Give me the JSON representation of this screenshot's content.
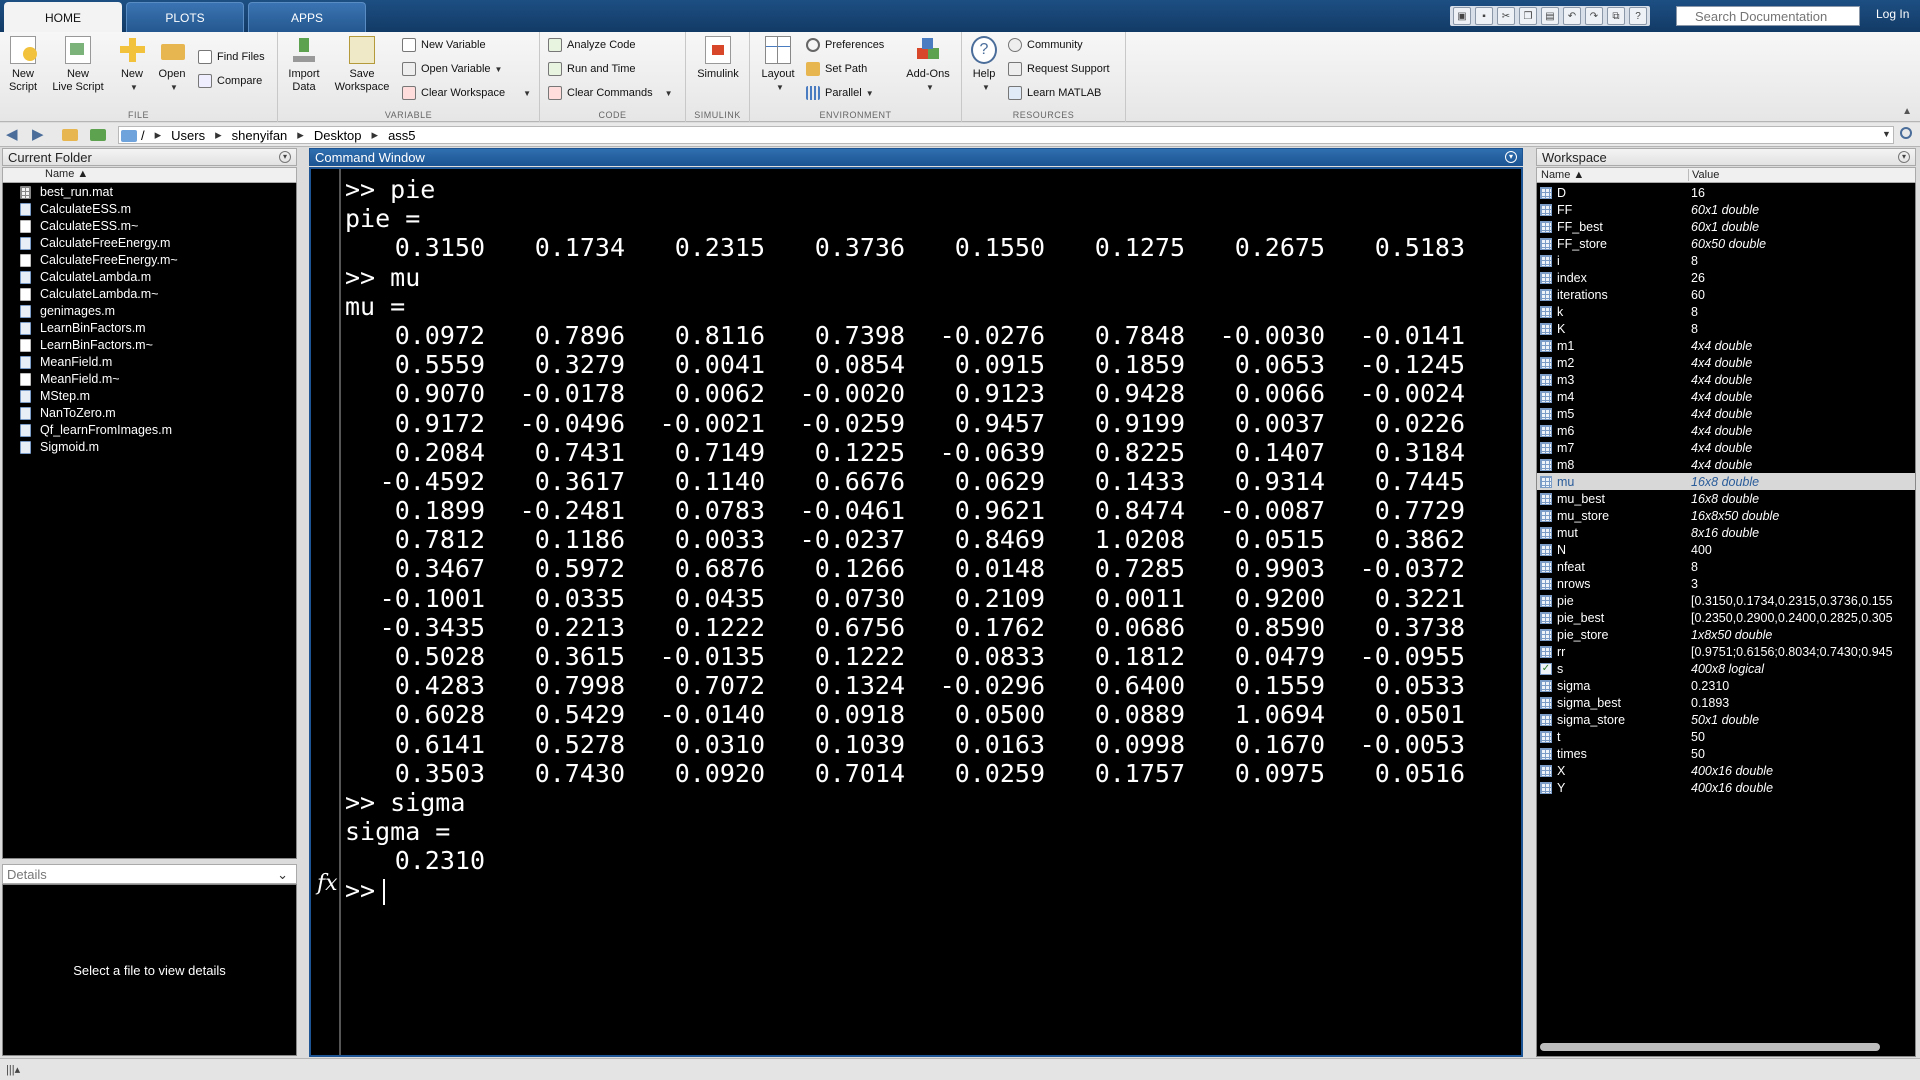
{
  "tabs": [
    "HOME",
    "PLOTS",
    "APPS"
  ],
  "search": {
    "placeholder": "Search Documentation"
  },
  "login": "Log In",
  "ribbon": {
    "file": {
      "label": "FILE",
      "new_script": "New\nScript",
      "new_live_script": "New\nLive Script",
      "new": "New",
      "open": "Open",
      "find_files": "Find Files",
      "compare": "Compare"
    },
    "variable": {
      "label": "VARIABLE",
      "import_data": "Import\nData",
      "save_workspace": "Save\nWorkspace",
      "new_variable": "New Variable",
      "open_variable": "Open Variable",
      "clear_workspace": "Clear Workspace"
    },
    "code": {
      "label": "CODE",
      "analyze_code": "Analyze Code",
      "run_and_time": "Run and Time",
      "clear_commands": "Clear Commands"
    },
    "simulink": {
      "label": "SIMULINK",
      "simulink": "Simulink"
    },
    "environment": {
      "label": "ENVIRONMENT",
      "layout": "Layout",
      "preferences": "Preferences",
      "set_path": "Set Path",
      "parallel": "Parallel",
      "add_ons": "Add-Ons"
    },
    "resources": {
      "label": "RESOURCES",
      "help": "Help",
      "community": "Community",
      "request_support": "Request Support",
      "learn_matlab": "Learn MATLAB"
    }
  },
  "path": [
    "/",
    "Users",
    "shenyifan",
    "Desktop",
    "ass5"
  ],
  "current_folder": {
    "title": "Current Folder",
    "col_name": "Name ▲",
    "files": [
      {
        "name": "best_run.mat",
        "type": "mat"
      },
      {
        "name": "CalculateESS.m",
        "type": "m"
      },
      {
        "name": "CalculateESS.m~",
        "type": "tilde"
      },
      {
        "name": "CalculateFreeEnergy.m",
        "type": "m"
      },
      {
        "name": "CalculateFreeEnergy.m~",
        "type": "tilde"
      },
      {
        "name": "CalculateLambda.m",
        "type": "m"
      },
      {
        "name": "CalculateLambda.m~",
        "type": "tilde"
      },
      {
        "name": "genimages.m",
        "type": "m"
      },
      {
        "name": "LearnBinFactors.m",
        "type": "m"
      },
      {
        "name": "LearnBinFactors.m~",
        "type": "tilde"
      },
      {
        "name": "MeanField.m",
        "type": "m"
      },
      {
        "name": "MeanField.m~",
        "type": "tilde"
      },
      {
        "name": "MStep.m",
        "type": "m"
      },
      {
        "name": "NanToZero.m",
        "type": "m"
      },
      {
        "name": "Qf_learnFromImages.m",
        "type": "m"
      },
      {
        "name": "Sigmoid.m",
        "type": "m"
      }
    ]
  },
  "details": {
    "title": "Details",
    "message": "Select a file to view details"
  },
  "command_window": {
    "title": "Command Window",
    "fx": "fx",
    "prompt": ">>",
    "lines": [
      {
        "kind": "text",
        "text": ">> pie"
      },
      {
        "kind": "text",
        "text": "pie ="
      },
      {
        "kind": "nums",
        "values": [
          "0.3150",
          "0.1734",
          "0.2315",
          "0.3736",
          "0.1550",
          "0.1275",
          "0.2675",
          "0.5183"
        ]
      },
      {
        "kind": "text",
        "text": ">> mu"
      },
      {
        "kind": "text",
        "text": "mu ="
      },
      {
        "kind": "nums",
        "values": [
          "0.0972",
          "0.7896",
          "0.8116",
          "0.7398",
          "-0.0276",
          "0.7848",
          "-0.0030",
          "-0.0141"
        ]
      },
      {
        "kind": "nums",
        "values": [
          "0.5559",
          "0.3279",
          "0.0041",
          "0.0854",
          "0.0915",
          "0.1859",
          "0.0653",
          "-0.1245"
        ]
      },
      {
        "kind": "nums",
        "values": [
          "0.9070",
          "-0.0178",
          "0.0062",
          "-0.0020",
          "0.9123",
          "0.9428",
          "0.0066",
          "-0.0024"
        ]
      },
      {
        "kind": "nums",
        "values": [
          "0.9172",
          "-0.0496",
          "-0.0021",
          "-0.0259",
          "0.9457",
          "0.9199",
          "0.0037",
          "0.0226"
        ]
      },
      {
        "kind": "nums",
        "values": [
          "0.2084",
          "0.7431",
          "0.7149",
          "0.1225",
          "-0.0639",
          "0.8225",
          "0.1407",
          "0.3184"
        ]
      },
      {
        "kind": "nums",
        "values": [
          "-0.4592",
          "0.3617",
          "0.1140",
          "0.6676",
          "0.0629",
          "0.1433",
          "0.9314",
          "0.7445"
        ]
      },
      {
        "kind": "nums",
        "values": [
          "0.1899",
          "-0.2481",
          "0.0783",
          "-0.0461",
          "0.9621",
          "0.8474",
          "-0.0087",
          "0.7729"
        ]
      },
      {
        "kind": "nums",
        "values": [
          "0.7812",
          "0.1186",
          "0.0033",
          "-0.0237",
          "0.8469",
          "1.0208",
          "0.0515",
          "0.3862"
        ]
      },
      {
        "kind": "nums",
        "values": [
          "0.3467",
          "0.5972",
          "0.6876",
          "0.1266",
          "0.0148",
          "0.7285",
          "0.9903",
          "-0.0372"
        ]
      },
      {
        "kind": "nums",
        "values": [
          "-0.1001",
          "0.0335",
          "0.0435",
          "0.0730",
          "0.2109",
          "0.0011",
          "0.9200",
          "0.3221"
        ]
      },
      {
        "kind": "nums",
        "values": [
          "-0.3435",
          "0.2213",
          "0.1222",
          "0.6756",
          "0.1762",
          "0.0686",
          "0.8590",
          "0.3738"
        ]
      },
      {
        "kind": "nums",
        "values": [
          "0.5028",
          "0.3615",
          "-0.0135",
          "0.1222",
          "0.0833",
          "0.1812",
          "0.0479",
          "-0.0955"
        ]
      },
      {
        "kind": "nums",
        "values": [
          "0.4283",
          "0.7998",
          "0.7072",
          "0.1324",
          "-0.0296",
          "0.6400",
          "0.1559",
          "0.0533"
        ]
      },
      {
        "kind": "nums",
        "values": [
          "0.6028",
          "0.5429",
          "-0.0140",
          "0.0918",
          "0.0500",
          "0.0889",
          "1.0694",
          "0.0501"
        ]
      },
      {
        "kind": "nums",
        "values": [
          "0.6141",
          "0.5278",
          "0.0310",
          "0.1039",
          "0.0163",
          "0.0998",
          "0.1670",
          "-0.0053"
        ]
      },
      {
        "kind": "nums",
        "values": [
          "0.3503",
          "0.7430",
          "0.0920",
          "0.7014",
          "0.0259",
          "0.1757",
          "0.0975",
          "0.0516"
        ]
      },
      {
        "kind": "text",
        "text": ">> sigma"
      },
      {
        "kind": "text",
        "text": "sigma ="
      },
      {
        "kind": "nums",
        "values": [
          "0.2310"
        ]
      }
    ]
  },
  "workspace": {
    "title": "Workspace",
    "col_name": "Name ▲",
    "col_value": "Value",
    "selected": "mu",
    "vars": [
      {
        "name": "D",
        "value": "16",
        "italic": false,
        "icon": "matrix"
      },
      {
        "name": "FF",
        "value": "60x1 double",
        "italic": true,
        "icon": "matrix"
      },
      {
        "name": "FF_best",
        "value": "60x1 double",
        "italic": true,
        "icon": "matrix"
      },
      {
        "name": "FF_store",
        "value": "60x50 double",
        "italic": true,
        "icon": "matrix"
      },
      {
        "name": "i",
        "value": "8",
        "italic": false,
        "icon": "matrix"
      },
      {
        "name": "index",
        "value": "26",
        "italic": false,
        "icon": "matrix"
      },
      {
        "name": "iterations",
        "value": "60",
        "italic": false,
        "icon": "matrix"
      },
      {
        "name": "k",
        "value": "8",
        "italic": false,
        "icon": "matrix"
      },
      {
        "name": "K",
        "value": "8",
        "italic": false,
        "icon": "matrix"
      },
      {
        "name": "m1",
        "value": "4x4 double",
        "italic": true,
        "icon": "matrix"
      },
      {
        "name": "m2",
        "value": "4x4 double",
        "italic": true,
        "icon": "matrix"
      },
      {
        "name": "m3",
        "value": "4x4 double",
        "italic": true,
        "icon": "matrix"
      },
      {
        "name": "m4",
        "value": "4x4 double",
        "italic": true,
        "icon": "matrix"
      },
      {
        "name": "m5",
        "value": "4x4 double",
        "italic": true,
        "icon": "matrix"
      },
      {
        "name": "m6",
        "value": "4x4 double",
        "italic": true,
        "icon": "matrix"
      },
      {
        "name": "m7",
        "value": "4x4 double",
        "italic": true,
        "icon": "matrix"
      },
      {
        "name": "m8",
        "value": "4x4 double",
        "italic": true,
        "icon": "matrix"
      },
      {
        "name": "mu",
        "value": "16x8 double",
        "italic": true,
        "icon": "matrix"
      },
      {
        "name": "mu_best",
        "value": "16x8 double",
        "italic": true,
        "icon": "matrix"
      },
      {
        "name": "mu_store",
        "value": "16x8x50 double",
        "italic": true,
        "icon": "matrix"
      },
      {
        "name": "mut",
        "value": "8x16 double",
        "italic": true,
        "icon": "matrix"
      },
      {
        "name": "N",
        "value": "400",
        "italic": false,
        "icon": "matrix"
      },
      {
        "name": "nfeat",
        "value": "8",
        "italic": false,
        "icon": "matrix"
      },
      {
        "name": "nrows",
        "value": "3",
        "italic": false,
        "icon": "matrix"
      },
      {
        "name": "pie",
        "value": "[0.3150,0.1734,0.2315,0.3736,0.155",
        "italic": false,
        "icon": "matrix"
      },
      {
        "name": "pie_best",
        "value": "[0.2350,0.2900,0.2400,0.2825,0.305",
        "italic": false,
        "icon": "matrix"
      },
      {
        "name": "pie_store",
        "value": "1x8x50 double",
        "italic": true,
        "icon": "matrix"
      },
      {
        "name": "rr",
        "value": "[0.9751;0.6156;0.8034;0.7430;0.945",
        "italic": false,
        "icon": "matrix"
      },
      {
        "name": "s",
        "value": "400x8 logical",
        "italic": true,
        "icon": "logical"
      },
      {
        "name": "sigma",
        "value": "0.2310",
        "italic": false,
        "icon": "matrix"
      },
      {
        "name": "sigma_best",
        "value": "0.1893",
        "italic": false,
        "icon": "matrix"
      },
      {
        "name": "sigma_store",
        "value": "50x1 double",
        "italic": true,
        "icon": "matrix"
      },
      {
        "name": "t",
        "value": "50",
        "italic": false,
        "icon": "matrix"
      },
      {
        "name": "times",
        "value": "50",
        "italic": false,
        "icon": "matrix"
      },
      {
        "name": "X",
        "value": "400x16 double",
        "italic": true,
        "icon": "matrix"
      },
      {
        "name": "Y",
        "value": "400x16 double",
        "italic": true,
        "icon": "matrix"
      }
    ]
  },
  "colors": {
    "titlebar": "#1d4f83",
    "active_panel": "#1d5594",
    "selection": "#d8d8d8"
  }
}
